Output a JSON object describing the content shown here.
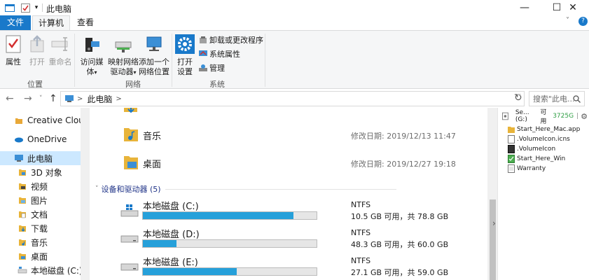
{
  "window": {
    "title": "此电脑",
    "controls": [
      "—",
      "☐",
      "✕"
    ]
  },
  "ribbon_tabs": [
    {
      "label": "文件"
    },
    {
      "label": "计算机"
    },
    {
      "label": "查看"
    }
  ],
  "ribbon": {
    "location_group": {
      "label": "位置",
      "properties": "属性",
      "open": "打开",
      "rename": "重命名"
    },
    "network_group": {
      "label": "网络",
      "access_media_1": "访问媒体",
      "map_drive_1": "映射网络",
      "map_drive_2": "驱动器",
      "add_location_1": "添加一个",
      "add_location_2": "网络位置"
    },
    "system_group": {
      "label": "系统",
      "open_settings_1": "打开",
      "open_settings_2": "设置",
      "uninstall": "卸载或更改程序",
      "system_properties": "系统属性",
      "manage": "管理"
    },
    "expand": "?"
  },
  "address": {
    "path": "此电脑",
    "separator": ">",
    "search_placeholder": "搜索\"此电..."
  },
  "nav_pane": {
    "items": [
      {
        "label": "Creative Cloud F"
      },
      {
        "label": "OneDrive"
      },
      {
        "label": "此电脑"
      },
      {
        "label": "3D 对象"
      },
      {
        "label": "视频"
      },
      {
        "label": "图片"
      },
      {
        "label": "文档"
      },
      {
        "label": "下载"
      },
      {
        "label": "音乐"
      },
      {
        "label": "桌面"
      },
      {
        "label": "本地磁盘 (C:)"
      }
    ]
  },
  "folders": [
    {
      "name": "音乐",
      "date_label": "修改日期:",
      "date": "2019/12/13 11:47"
    },
    {
      "name": "桌面",
      "date_label": "修改日期:",
      "date": "2019/12/27 19:18"
    }
  ],
  "devices_section": {
    "label": "设备和驱动器 (5)"
  },
  "drives": [
    {
      "name": "本地磁盘 (C:)",
      "fs": "NTFS",
      "free": "10.5 GB 可用，共 78.8 GB",
      "used_fraction": 0.867
    },
    {
      "name": "本地磁盘 (D:)",
      "fs": "NTFS",
      "free": "48.3 GB 可用，共 60.0 GB",
      "used_fraction": 0.195
    },
    {
      "name": "本地磁盘 (E:)",
      "fs": "NTFS",
      "free": "27.1 GB 可用，共 59.0 GB",
      "used_fraction": 0.541
    }
  ],
  "preview": {
    "drive_name": "Se...(G:)",
    "free_label": "可用",
    "free_value": "3725G",
    "items": [
      {
        "name": "Start_Here_Mac.app"
      },
      {
        "name": ".VolumeIcon.icns"
      },
      {
        "name": ".VolumeIcon"
      },
      {
        "name": "Start_Here_Win"
      },
      {
        "name": "Warranty"
      }
    ]
  },
  "colors": {
    "accent": "#1979ca",
    "selected": "#cce8ff",
    "drive_bar": "#26a0da",
    "free_space": "#2e9e43"
  }
}
